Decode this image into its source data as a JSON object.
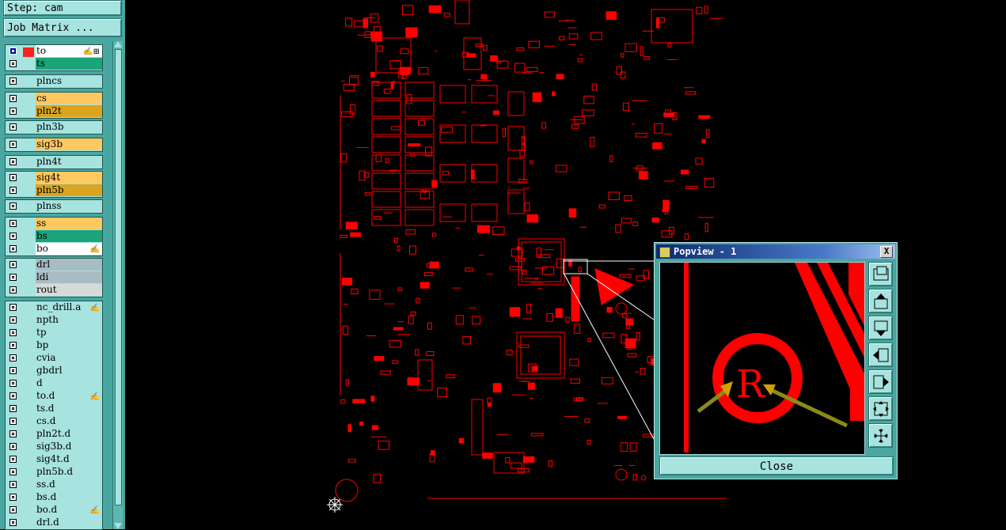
{
  "step": {
    "label": "Step: cam"
  },
  "job_matrix": {
    "label": "Job Matrix ..."
  },
  "layers": [
    {
      "name": "to",
      "color": "white",
      "active": true,
      "mark": "✍⊞"
    },
    {
      "name": "ts",
      "color": "teal"
    },
    {
      "name": "plncs",
      "color": "light"
    },
    {
      "name": "cs",
      "color": "orange"
    },
    {
      "name": "pln2t",
      "color": "gold"
    },
    {
      "name": "pln3b",
      "color": "light"
    },
    {
      "name": "sig3b",
      "color": "orange"
    },
    {
      "name": "pln4t",
      "color": "light"
    },
    {
      "name": "sig4t",
      "color": "orange"
    },
    {
      "name": "pln5b",
      "color": "gold"
    },
    {
      "name": "plnss",
      "color": "light"
    },
    {
      "name": "ss",
      "color": "orange"
    },
    {
      "name": "bs",
      "color": "teal"
    },
    {
      "name": "bo",
      "color": "white",
      "mark": "✍"
    },
    {
      "name": "drl",
      "color": "grey"
    },
    {
      "name": "ldi",
      "color": "grey"
    },
    {
      "name": "rout",
      "color": "lgrey"
    },
    {
      "name": "nc_drill.a",
      "color": "light",
      "mark": "✍"
    },
    {
      "name": "npth",
      "color": "light"
    },
    {
      "name": "tp",
      "color": "light"
    },
    {
      "name": "bp",
      "color": "light"
    },
    {
      "name": "cvia",
      "color": "light"
    },
    {
      "name": "gbdrl",
      "color": "light"
    },
    {
      "name": "d",
      "color": "light"
    },
    {
      "name": "to.d",
      "color": "light",
      "mark": "✍"
    },
    {
      "name": "ts.d",
      "color": "light"
    },
    {
      "name": "cs.d",
      "color": "light"
    },
    {
      "name": "pln2t.d",
      "color": "light"
    },
    {
      "name": "sig3b.d",
      "color": "light"
    },
    {
      "name": "sig4t.d",
      "color": "light"
    },
    {
      "name": "pln5b.d",
      "color": "light"
    },
    {
      "name": "ss.d",
      "color": "light"
    },
    {
      "name": "bs.d",
      "color": "light"
    },
    {
      "name": "bo.d",
      "color": "light",
      "mark": "✍"
    },
    {
      "name": "drl.d",
      "color": "light"
    }
  ],
  "popview": {
    "title": "Popview - 1",
    "close_x": "X",
    "close_label": "Close",
    "zoom_text": "R"
  },
  "colors": {
    "trace": "#ff0000",
    "panel": "#4aa6a0",
    "arrow": "#8a8a1a"
  }
}
